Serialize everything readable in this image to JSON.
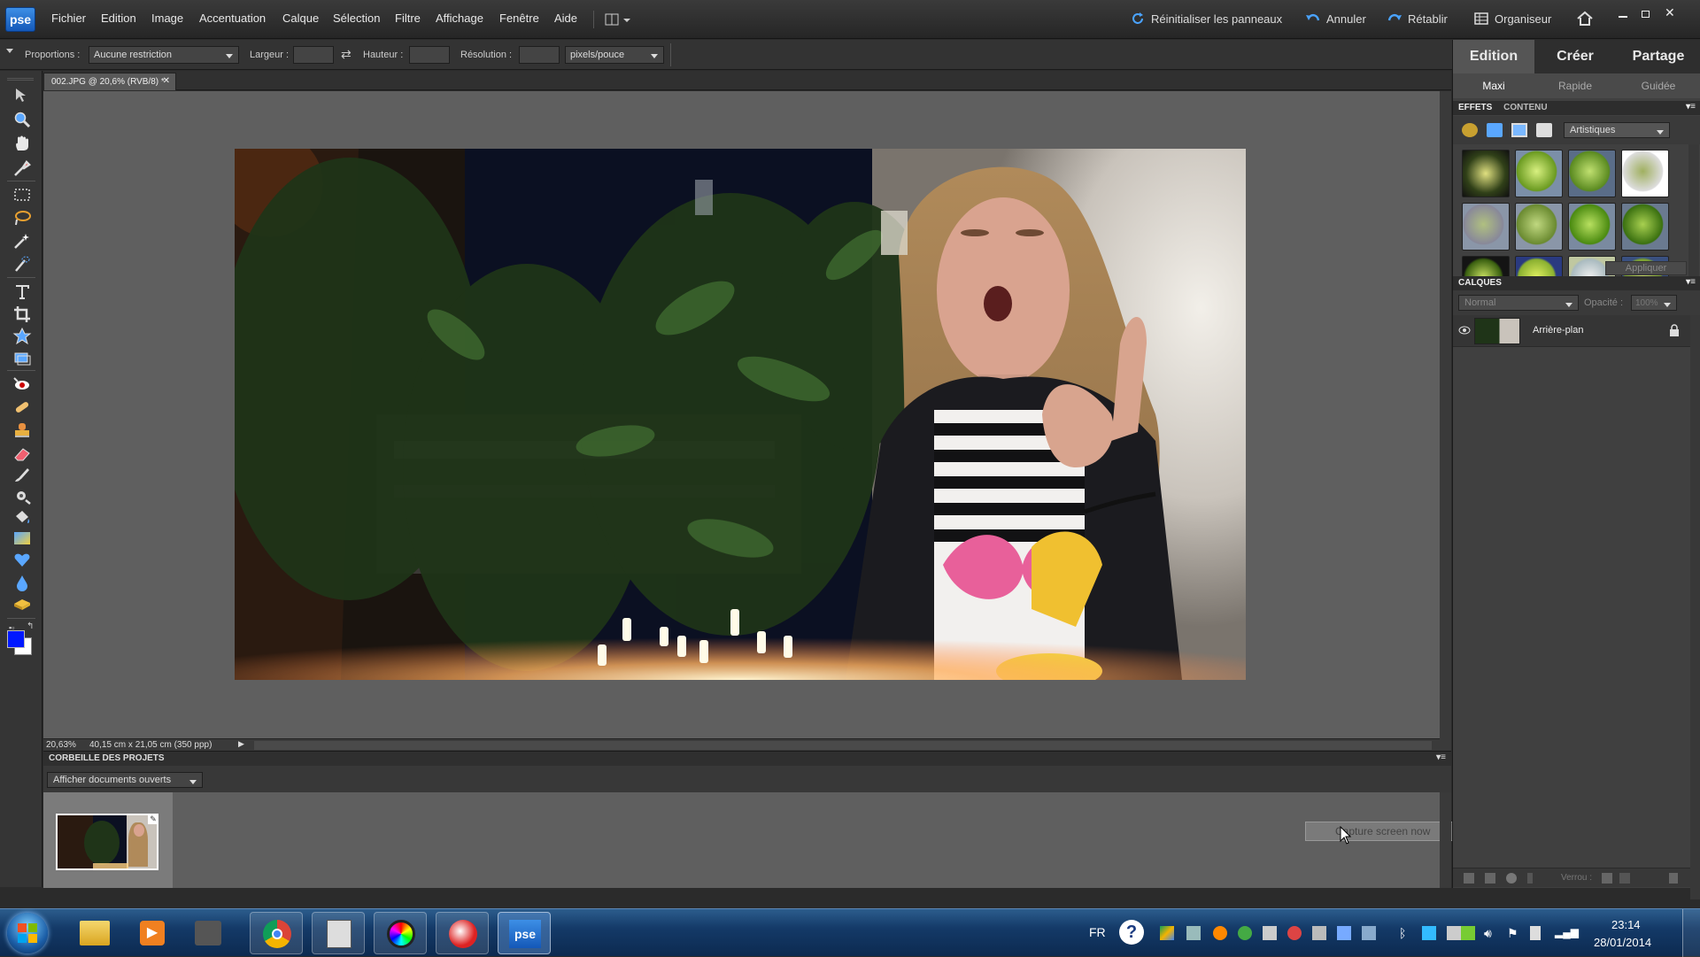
{
  "app": {
    "logo": "pse"
  },
  "menu": {
    "items": [
      "Fichier",
      "Edition",
      "Image",
      "Accentuation",
      "Calque",
      "Sélection",
      "Filtre",
      "Affichage",
      "Fenêtre",
      "Aide"
    ]
  },
  "topbar": {
    "reset_panels": "Réinitialiser les panneaux",
    "undo": "Annuler",
    "redo": "Rétablir",
    "organizer": "Organiseur"
  },
  "options": {
    "proportions_label": "Proportions :",
    "proportions_value": "Aucune restriction",
    "width_label": "Largeur :",
    "width_value": "",
    "height_label": "Hauteur :",
    "height_value": "",
    "resolution_label": "Résolution :",
    "resolution_value": "",
    "unit_value": "pixels/pouce"
  },
  "document": {
    "tab_title": "002.JPG @ 20,6% (RVB/8) *",
    "zoom": "20,63%",
    "size_info": "40,15 cm x 21,05 cm (350 ppp)"
  },
  "bin": {
    "title": "CORBEILLE DES PROJETS",
    "filter": "Afficher documents ouverts",
    "capture_text": "Capture screen now"
  },
  "right": {
    "tabs": [
      "Edition",
      "Créer",
      "Partage"
    ],
    "subtabs": [
      "Maxi",
      "Rapide",
      "Guidée"
    ],
    "effects": {
      "tab_effects": "EFFETS",
      "tab_content": "CONTENU",
      "category": "Artistiques",
      "apply": "Appliquer"
    },
    "layers": {
      "title": "CALQUES",
      "blend": "Normal",
      "opacity_label": "Opacité :",
      "opacity_value": "100%",
      "layer_name": "Arrière-plan",
      "lock_label": "Verrou :"
    }
  },
  "taskbar": {
    "lang": "FR",
    "time": "23:14",
    "date": "28/01/2014"
  },
  "colors": {
    "accent": "#1f6fd1",
    "foreground": "#0018ff",
    "background": "#ffffff"
  }
}
